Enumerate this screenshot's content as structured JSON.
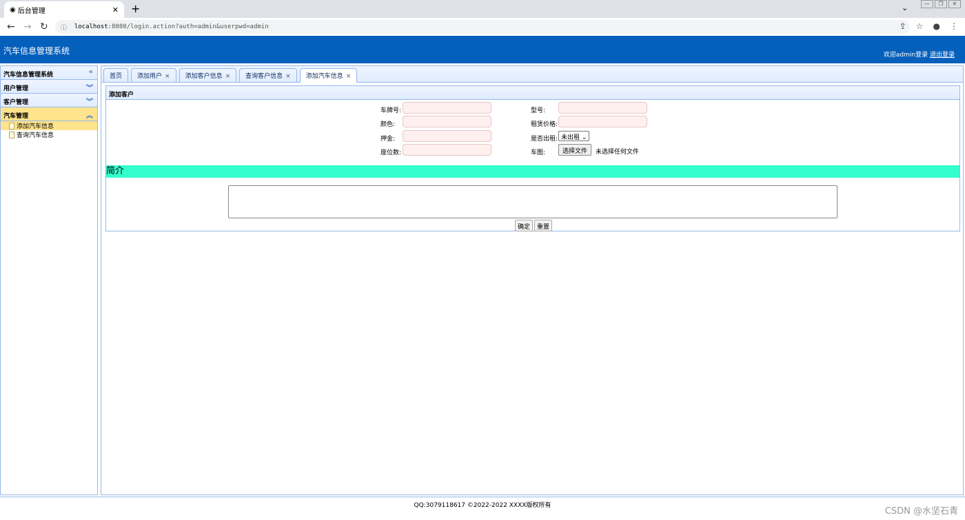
{
  "browser": {
    "tab_title": "后台管理",
    "url_host": "localhost",
    "url_rest": ":8080/login.action?auth=admin&userpwd=admin"
  },
  "header": {
    "title": "汽车信息管理系统",
    "welcome": "欢迎admin登录",
    "logout": "退出登录"
  },
  "sidebar": {
    "title": "汽车信息管理系统",
    "groups": [
      {
        "label": "用户管理"
      },
      {
        "label": "客户管理"
      },
      {
        "label": "汽车管理"
      }
    ],
    "items": [
      {
        "label": "添加汽车信息"
      },
      {
        "label": "查询汽车信息"
      }
    ]
  },
  "tabs": [
    {
      "label": "首页"
    },
    {
      "label": "添加用户"
    },
    {
      "label": "添加客户信息"
    },
    {
      "label": "查询客户信息"
    },
    {
      "label": "添加汽车信息"
    }
  ],
  "form": {
    "panel_title": "添加客户",
    "plate_label": "车牌号:",
    "model_label": "型号:",
    "color_label": "颜色:",
    "price_label": "租赁价格:",
    "deposit_label": "押金:",
    "rented_label": "是否出租:",
    "rented_value": "未出租",
    "seats_label": "座位数:",
    "image_label": "车图:",
    "file_button": "选择文件",
    "file_status": "未选择任何文件",
    "intro_label": "简介",
    "submit": "确定",
    "reset": "重置"
  },
  "footer": {
    "text": "QQ:3079118617 ©2022-2022 XXXX版权所有"
  },
  "watermark": "CSDN @水坚石青"
}
